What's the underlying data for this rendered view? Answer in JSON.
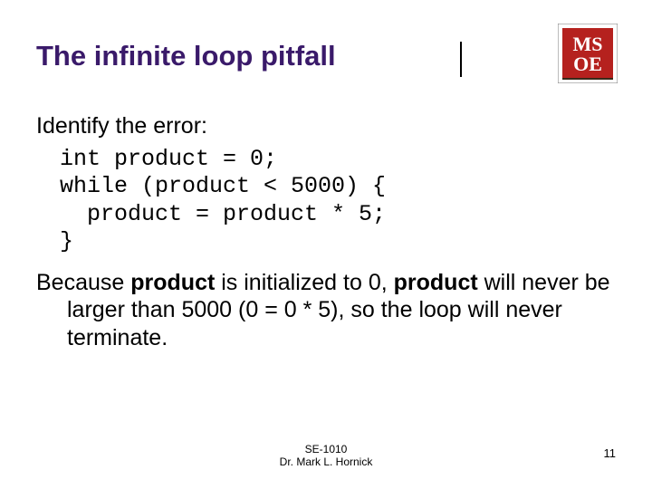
{
  "slide": {
    "title": "The infinite loop pitfall",
    "lead": "Identify the error:",
    "code": "int product = 0;\nwhile (product < 5000) {\n  product = product * 5;\n}",
    "explain_parts": {
      "p1": "Because ",
      "p2": "product",
      "p3": " is initialized to 0, ",
      "p4": "product",
      "p5": " will never be larger than 5000 (0 = 0 * 5), so the loop will never terminate."
    }
  },
  "footer": {
    "course": "SE-1010",
    "author": "Dr. Mark L. Hornick"
  },
  "page_number": "11",
  "logo": {
    "bg": "#b5211e",
    "text_top": "MS",
    "text_bottom": "OE"
  }
}
